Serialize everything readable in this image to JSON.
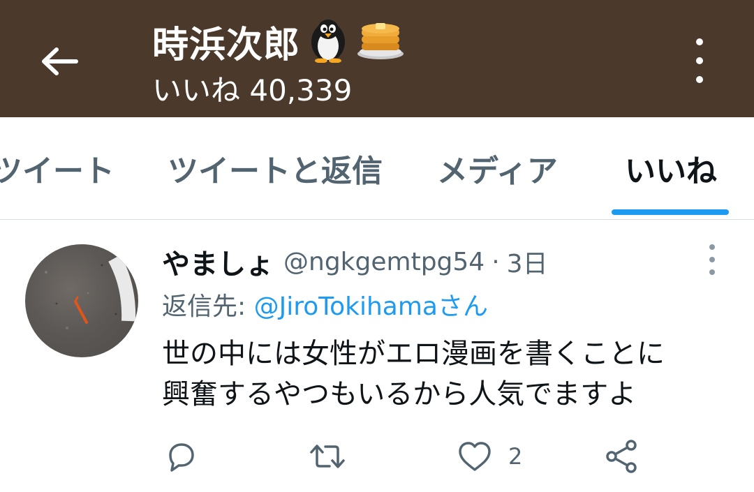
{
  "header": {
    "back_icon": "arrow-left-icon",
    "display_name": "時浜次郎",
    "name_emojis": [
      "penguin-icon",
      "pancakes-icon"
    ],
    "likes_summary": "いいね 40,339",
    "more_icon": "more-vertical-icon",
    "background_color": "#4b3a2b"
  },
  "tabs": [
    {
      "label": "ツイート",
      "active": false
    },
    {
      "label": "ツイートと返信",
      "active": false
    },
    {
      "label": "メディア",
      "active": false
    },
    {
      "label": "いいね",
      "active": true
    }
  ],
  "tweet": {
    "author_name": "やましょ",
    "author_handle": "@ngkgemtpg54",
    "separator": "·",
    "time": "3日",
    "reply_prefix": "返信先: ",
    "reply_target": "@JiroTokihamaさん",
    "text_lines": [
      "世の中には女性がエロ漫画を書くことに",
      "興奮するやつもいるから人気でますよ"
    ],
    "actions": {
      "reply_icon": "reply-icon",
      "retweet_icon": "retweet-icon",
      "like_icon": "heart-icon",
      "like_count": "2",
      "share_icon": "share-icon"
    }
  },
  "colors": {
    "accent": "#1d9bf0",
    "secondary_text": "#536471",
    "primary_text": "#0f1419"
  }
}
